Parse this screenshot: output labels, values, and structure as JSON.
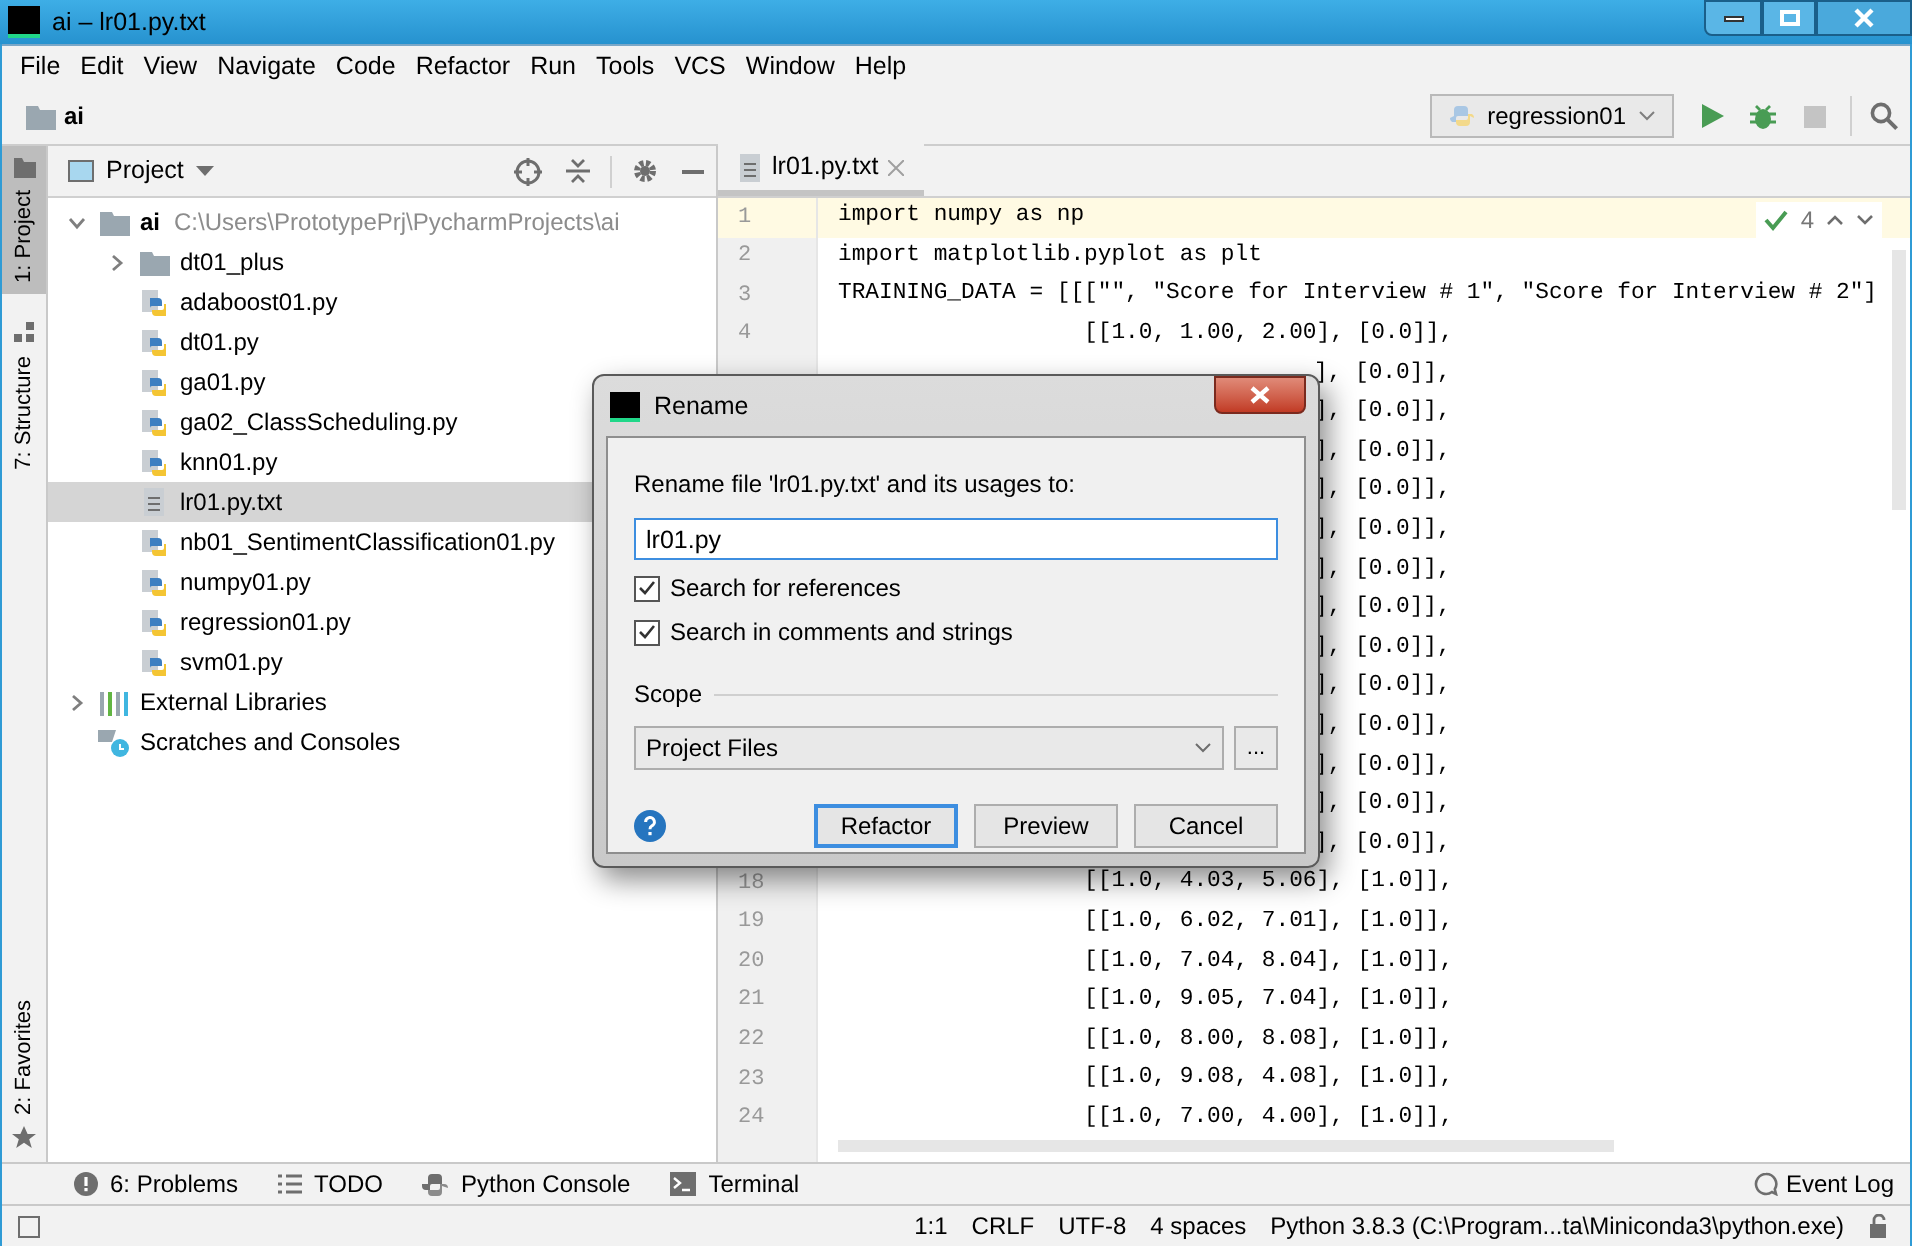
{
  "window": {
    "title": "ai – lr01.py.txt"
  },
  "menu": [
    "File",
    "Edit",
    "View",
    "Navigate",
    "Code",
    "Refactor",
    "Run",
    "Tools",
    "VCS",
    "Window",
    "Help"
  ],
  "nav_bar": {
    "breadcrumb": "ai",
    "run_config": "regression01"
  },
  "left_stripe": [
    {
      "label": "1: Project",
      "selected": true,
      "kind": "project"
    },
    {
      "label": "7: Structure",
      "selected": false,
      "kind": "structure"
    },
    {
      "label": "2: Favorites",
      "selected": false,
      "kind": "favorites"
    }
  ],
  "project_panel": {
    "title": "Project",
    "tree": [
      {
        "name": "ai",
        "path": "C:\\Users\\PrototypePrj\\PycharmProjects\\ai",
        "kind": "folder",
        "expanded": true,
        "selected": false,
        "children": [
          {
            "name": "dt01_plus",
            "kind": "folder",
            "expanded": false,
            "selected": false
          },
          {
            "name": "adaboost01.py",
            "kind": "python",
            "selected": false
          },
          {
            "name": "dt01.py",
            "kind": "python",
            "selected": false
          },
          {
            "name": "ga01.py",
            "kind": "python",
            "selected": false
          },
          {
            "name": "ga02_ClassScheduling.py",
            "kind": "python",
            "selected": false
          },
          {
            "name": "knn01.py",
            "kind": "python",
            "selected": false
          },
          {
            "name": "lr01.py.txt",
            "kind": "text",
            "selected": true
          },
          {
            "name": "nb01_SentimentClassification01.py",
            "kind": "python",
            "selected": false
          },
          {
            "name": "numpy01.py",
            "kind": "python",
            "selected": false
          },
          {
            "name": "regression01.py",
            "kind": "python",
            "selected": false
          },
          {
            "name": "svm01.py",
            "kind": "python",
            "selected": false
          }
        ]
      },
      {
        "name": "External Libraries",
        "kind": "library",
        "expanded": false,
        "selected": false
      },
      {
        "name": "Scratches and Consoles",
        "kind": "scratches",
        "selected": false
      }
    ]
  },
  "editor": {
    "tab": "lr01.py.txt",
    "inspection_count": "4",
    "lines": [
      {
        "kind": "line",
        "number": "1",
        "text": "import numpy as np",
        "current": true
      },
      {
        "kind": "line",
        "number": "2",
        "text": "import matplotlib.pyplot as plt",
        "current": false
      },
      {
        "kind": "line",
        "number": "3",
        "text": "TRAINING_DATA = [[[\"\", \"Score for Interview # 1\", \"Score for Interview # 2\"]",
        "current": false
      },
      {
        "kind": "line",
        "number": "4",
        "text": "                  [[1.0, 1.00, 2.00], [0.0]],",
        "current": false
      },
      {
        "kind": "covered",
        "text": "], [0.0]],"
      },
      {
        "kind": "covered",
        "text": "], [0.0]],"
      },
      {
        "kind": "covered",
        "text": "], [0.0]],"
      },
      {
        "kind": "covered",
        "text": "], [0.0]],"
      },
      {
        "kind": "covered",
        "text": "], [0.0]],"
      },
      {
        "kind": "covered",
        "text": "], [0.0]],"
      },
      {
        "kind": "covered",
        "text": "], [0.0]],"
      },
      {
        "kind": "covered",
        "text": "], [0.0]],"
      },
      {
        "kind": "covered",
        "text": "], [0.0]],"
      },
      {
        "kind": "covered",
        "text": "], [0.0]],"
      },
      {
        "kind": "covered",
        "text": "], [0.0]],"
      },
      {
        "kind": "covered",
        "text": "], [0.0]],"
      },
      {
        "kind": "covered",
        "text": "], [0.0]],"
      },
      {
        "kind": "line",
        "number": "18",
        "text": "                  [[1.0, 4.03, 5.06], [1.0]],",
        "current": false
      },
      {
        "kind": "line",
        "number": "19",
        "text": "                  [[1.0, 6.02, 7.01], [1.0]],",
        "current": false
      },
      {
        "kind": "line",
        "number": "20",
        "text": "                  [[1.0, 7.04, 8.04], [1.0]],",
        "current": false
      },
      {
        "kind": "line",
        "number": "21",
        "text": "                  [[1.0, 9.05, 7.04], [1.0]],",
        "current": false
      },
      {
        "kind": "line",
        "number": "22",
        "text": "                  [[1.0, 8.00, 8.08], [1.0]],",
        "current": false
      },
      {
        "kind": "line",
        "number": "23",
        "text": "                  [[1.0, 9.08, 4.08], [1.0]],",
        "current": false
      },
      {
        "kind": "line",
        "number": "24",
        "text": "                  [[1.0, 7.00, 4.00], [1.0]],",
        "current": false
      }
    ]
  },
  "dialog": {
    "title": "Rename",
    "prompt": "Rename file 'lr01.py.txt' and its usages to:",
    "value": "lr01.py",
    "options": [
      {
        "label": "Search for references",
        "checked": true
      },
      {
        "label": "Search in comments and strings",
        "checked": true
      }
    ],
    "scope_label": "Scope",
    "scope": "Project Files",
    "browse": "...",
    "buttons": [
      {
        "label": "Refactor",
        "default": true
      },
      {
        "label": "Preview",
        "default": false
      },
      {
        "label": "Cancel",
        "default": false
      }
    ]
  },
  "bottom_tools": [
    {
      "label": "6: Problems",
      "kind": "problems"
    },
    {
      "label": "TODO",
      "kind": "todo"
    },
    {
      "label": "Python Console",
      "kind": "python"
    },
    {
      "label": "Terminal",
      "kind": "terminal"
    }
  ],
  "event_log": "Event Log",
  "status_bar": [
    "1:1",
    "CRLF",
    "UTF-8",
    "4 spaces",
    "Python 3.8.3 (C:\\Program...ta\\Miniconda3\\python.exe)"
  ]
}
